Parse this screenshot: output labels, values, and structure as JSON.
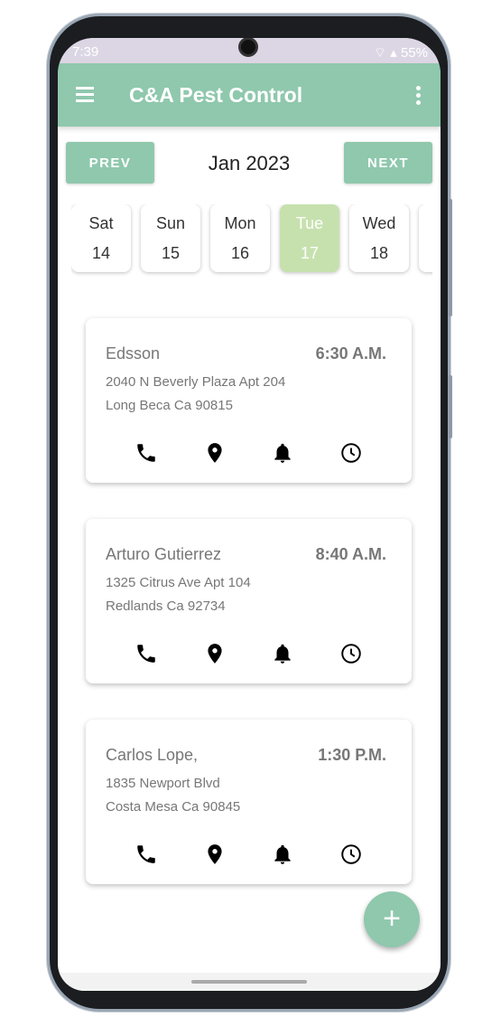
{
  "status": {
    "time": "7:39",
    "battery": "55%"
  },
  "appbar": {
    "title": "C&A Pest Control"
  },
  "calendar": {
    "prev": "PREV",
    "next": "NEXT",
    "month": "Jan 2023",
    "days": [
      {
        "name": "Sat",
        "date": "14"
      },
      {
        "name": "Sun",
        "date": "15"
      },
      {
        "name": "Mon",
        "date": "16"
      },
      {
        "name": "Tue",
        "date": "17",
        "selected": true
      },
      {
        "name": "Wed",
        "date": "18"
      }
    ]
  },
  "appointments": [
    {
      "name": "Edsson",
      "time": "6:30 A.M.",
      "address1": "2040 N Beverly Plaza Apt 204",
      "address2": "Long Beca Ca  90815"
    },
    {
      "name": "Arturo Gutierrez",
      "time": "8:40 A.M.",
      "address1": "1325 Citrus Ave Apt 104",
      "address2": "Redlands  Ca  92734"
    },
    {
      "name": "Carlos Lope,",
      "time": "1:30 P.M.",
      "address1": "1835 Newport Blvd",
      "address2": "Costa Mesa Ca  90845"
    }
  ],
  "fab": {
    "label": "+"
  },
  "colors": {
    "accent": "#8fc8ad",
    "selected_day": "#c6e1ae",
    "status_bar": "#dcd6e4"
  }
}
